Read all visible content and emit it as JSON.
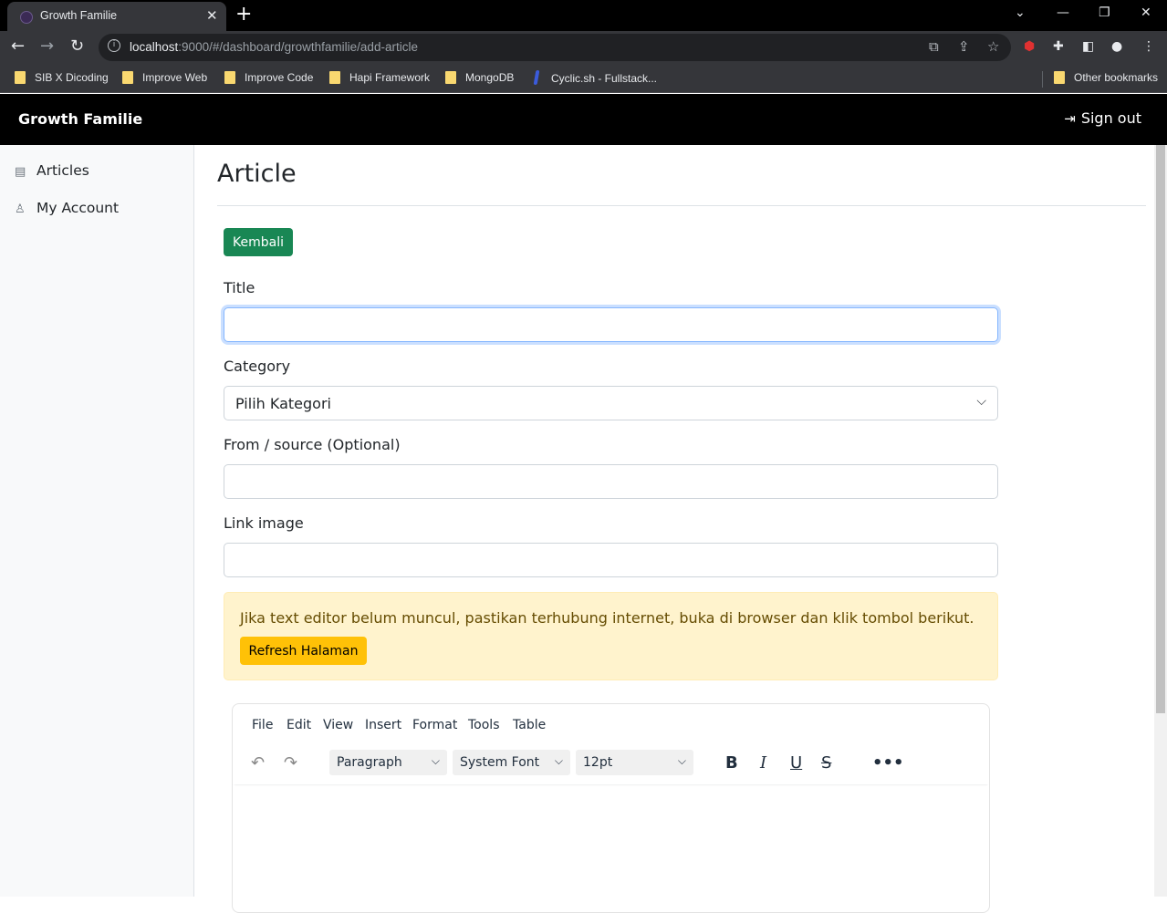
{
  "browser": {
    "tab_title": "Growth Familie",
    "tab_close": "✕",
    "new_tab": "+",
    "url_host": "localhost",
    "url_rest": ":9000/#/dashboard/growthfamilie/add-article",
    "bookmarks": [
      "SIB X Dicoding",
      "Improve Web",
      "Improve Code",
      "Hapi Framework",
      "MongoDB",
      "Cyclic.sh - Fullstack...",
      "Other bookmarks"
    ]
  },
  "app": {
    "brand": "Growth Familie",
    "signout_label": "Sign out"
  },
  "sidebar": {
    "items": [
      {
        "label": "Articles",
        "icon": "file-text-icon"
      },
      {
        "label": "My Account",
        "icon": "person-icon"
      }
    ]
  },
  "main": {
    "title": "Article",
    "back_button": "Kembali",
    "form": {
      "title_label": "Title",
      "title_value": "",
      "category_label": "Category",
      "category_value": "Pilih Kategori",
      "source_label": "From / source (Optional)",
      "source_value": "",
      "image_label": "Link image",
      "image_value": ""
    },
    "alert": {
      "message": "Jika text editor belum muncul, pastikan terhubung internet, buka di browser dan klik tombol berikut.",
      "button": "Refresh Halaman"
    },
    "editor": {
      "menus": [
        "File",
        "Edit",
        "View",
        "Insert",
        "Format",
        "Tools",
        "Table"
      ],
      "block_format": "Paragraph",
      "font_family": "System Font",
      "font_size": "12pt"
    }
  },
  "colors": {
    "success": "#198754",
    "warning": "#ffc107",
    "alert_bg": "#fff3cd",
    "header_bg": "#000000"
  }
}
